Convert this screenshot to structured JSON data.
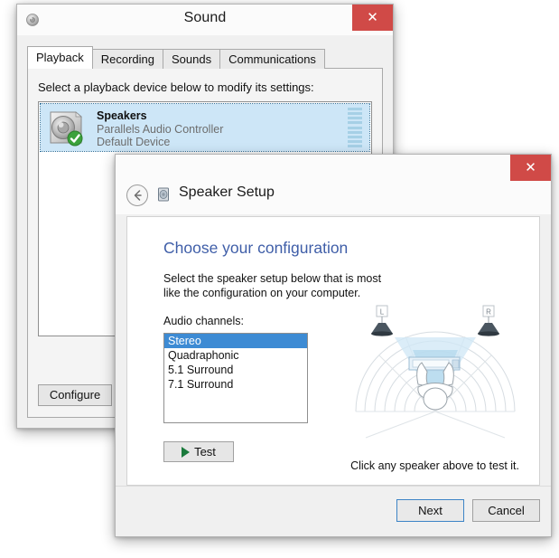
{
  "sound_window": {
    "title": "Sound",
    "icon": "speaker-icon",
    "close_label": "✕",
    "tabs": [
      {
        "label": "Playback",
        "active": true
      },
      {
        "label": "Recording",
        "active": false
      },
      {
        "label": "Sounds",
        "active": false
      },
      {
        "label": "Communications",
        "active": false
      }
    ],
    "panel_label": "Select a playback device below to modify its settings:",
    "devices": [
      {
        "name": "Speakers",
        "driver": "Parallels Audio Controller",
        "status": "Default Device",
        "selected": true,
        "badge": "default-check"
      }
    ],
    "configure_button": "Configure"
  },
  "setup_window": {
    "title_icon": "speaker-setup-icon",
    "close_label": "✕",
    "back_label": "←",
    "heading": "Speaker Setup",
    "choose_title": "Choose your configuration",
    "instruction": "Select the speaker setup below that is most like the configuration on your computer.",
    "audio_channels_label": "Audio channels:",
    "channel_options": [
      {
        "label": "Stereo",
        "selected": true
      },
      {
        "label": "Quadraphonic",
        "selected": false
      },
      {
        "label": "5.1 Surround",
        "selected": false
      },
      {
        "label": "7.1 Surround",
        "selected": false
      }
    ],
    "test_button": "Test",
    "click_hint": "Click any speaker above to test it.",
    "diagram": {
      "left_speaker_label": "L",
      "right_speaker_label": "R"
    },
    "next_button": "Next",
    "cancel_button": "Cancel"
  },
  "colors": {
    "close_red": "#d04a47",
    "selection_blue": "#3d8bd4",
    "heading_blue": "#3f5ea8",
    "row_highlight": "#cde6f7",
    "play_green": "#1a7a3c",
    "focus_border": "#3d84c6"
  }
}
